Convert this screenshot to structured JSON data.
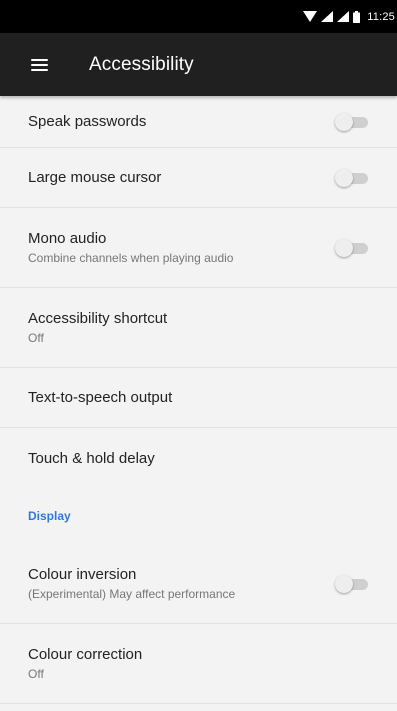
{
  "status_bar": {
    "time": "11:25",
    "icons": [
      "wifi-icon",
      "signal-icon",
      "signal-icon",
      "battery-icon"
    ]
  },
  "toolbar": {
    "menu_icon": "menu-icon",
    "title": "Accessibility"
  },
  "settings": {
    "speak_passwords": {
      "title": "Speak passwords",
      "toggle_on": false
    },
    "large_mouse_cursor": {
      "title": "Large mouse cursor",
      "toggle_on": false
    },
    "mono_audio": {
      "title": "Mono audio",
      "summary": "Combine channels when playing audio",
      "toggle_on": false
    },
    "accessibility_shortcut": {
      "title": "Accessibility shortcut",
      "summary": "Off"
    },
    "tts_output": {
      "title": "Text-to-speech output"
    },
    "touch_hold_delay": {
      "title": "Touch & hold delay"
    },
    "display_header": "Display",
    "colour_inversion": {
      "title": "Colour inversion",
      "summary": "(Experimental) May affect performance",
      "toggle_on": false
    },
    "colour_correction": {
      "title": "Colour correction",
      "summary": "Off"
    }
  },
  "colors": {
    "toolbar_bg": "#202020",
    "status_bar_bg": "#000000",
    "list_bg": "#f3f3f3",
    "accent": "#2e7bd6",
    "switch_track_off": "#cfcfcf",
    "switch_thumb_off": "#eeeeee"
  }
}
